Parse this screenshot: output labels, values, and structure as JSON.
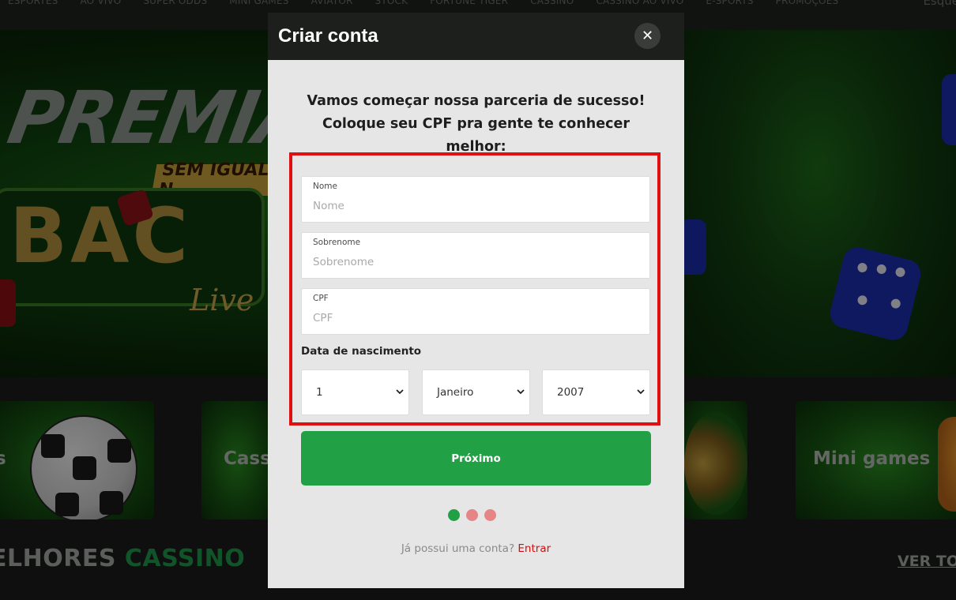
{
  "nav": {
    "items": [
      "ESPORTES",
      "AO VIVO",
      "SUPER ODDS",
      "MINI GAMES",
      "AVIATOR",
      "STOCK",
      "FORTUNE TIGER",
      "CASSINO",
      "CASSINO AO VIVO",
      "E-SPORTS",
      "PROMOÇÕES"
    ],
    "right_text": "Esque"
  },
  "hero": {
    "title": "PREMIAÇ",
    "banner": "SEM IGUAL N",
    "bac": "BAC",
    "live": "Live"
  },
  "categories": {
    "card_1": "s",
    "card_2": "Cass",
    "card_3": "",
    "card_4": "Mini games"
  },
  "section": {
    "title_white": "ELHORES ",
    "title_green": "CASSINO",
    "see_all": "VER TO"
  },
  "modal": {
    "title": "Criar conta",
    "close_glyph": "✕",
    "intro_line1": "Vamos começar nossa parceria de sucesso!",
    "intro_line2": "Coloque seu CPF pra gente te conhecer",
    "intro_line3": "melhor:",
    "fields": {
      "nome_label": "Nome",
      "nome_placeholder": "Nome",
      "sobrenome_label": "Sobrenome",
      "sobrenome_placeholder": "Sobrenome",
      "cpf_label": "CPF",
      "cpf_placeholder": "CPF"
    },
    "dob": {
      "label": "Data de nascimento",
      "day": "1",
      "month": "Janeiro",
      "year": "2007"
    },
    "next_button": "Próximo",
    "steps": {
      "total": 3,
      "current": 1
    },
    "login_prompt": "Já possui uma conta?",
    "login_link": "Entrar"
  },
  "colors": {
    "accent_green": "#22a045",
    "step_active": "#22a045",
    "step_inactive": "#e58585",
    "highlight_red": "#e01010",
    "link_red": "#d10f10"
  }
}
